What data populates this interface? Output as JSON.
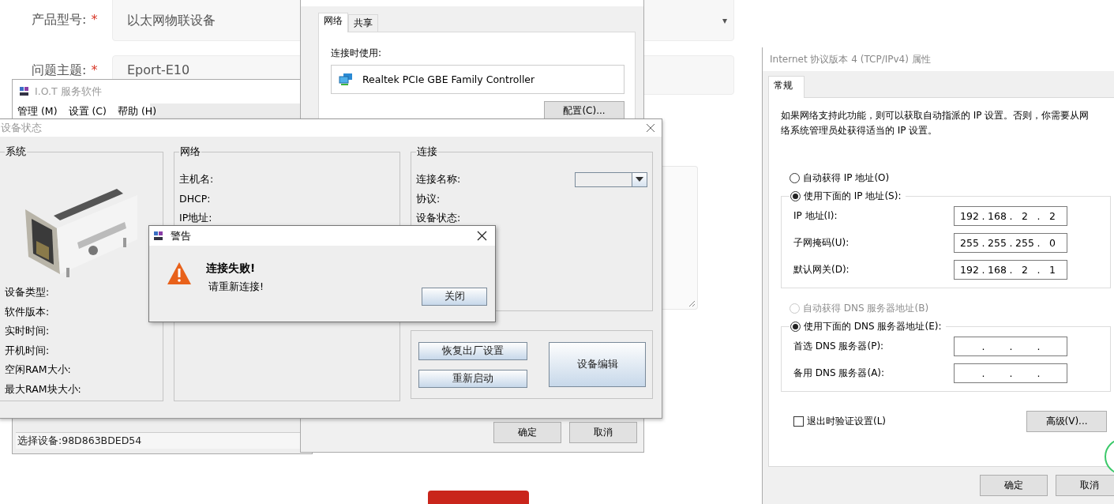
{
  "web_form": {
    "fields": [
      {
        "label": "产品型号:",
        "required_mark": "*",
        "value": "以太网物联设备",
        "caret": "▾"
      },
      {
        "label": "问题主题:",
        "required_mark": "*",
        "value": "Eport-E10"
      }
    ]
  },
  "iot_window": {
    "title": "I.O.T 服务软件",
    "menu": [
      "管理 (M)",
      "设置 (C)",
      "帮助 (H)"
    ],
    "status": "选择设备:98D863BDED54"
  },
  "adapter_window": {
    "tabs": [
      {
        "label": "网络",
        "selected": true
      },
      {
        "label": "共享",
        "selected": false
      }
    ],
    "connect_using": "连接时使用:",
    "adapter": "Realtek PCIe GBE Family Controller",
    "configure_button": "配置(C)...",
    "buttons": [
      "确定",
      "取消"
    ]
  },
  "device_status_window": {
    "title": "设备状态",
    "system_group": {
      "title": "系统",
      "fields": [
        "设备类型:",
        "软件版本:",
        "实时时间:",
        "开机时间:",
        "空闲RAM大小:",
        "最大RAM块大小:"
      ]
    },
    "network_group": {
      "title": "网络",
      "fields": [
        "主机名:",
        "DHCP:",
        "IP地址:"
      ]
    },
    "connection_group": {
      "title": "连接",
      "fields": [
        "连接名称:",
        "协议:",
        "设备状态:"
      ]
    },
    "buttons": [
      "恢复出厂设置",
      "重新启动",
      "设备编辑"
    ]
  },
  "warning_dialog": {
    "title": "警告",
    "heading": "连接失败!",
    "message": "请重新连接!",
    "button": "关闭"
  },
  "ipv4_window": {
    "title": "Internet 协议版本 4 (TCP/IPv4) 属性",
    "tabs": [
      {
        "label": "常规",
        "selected": true
      }
    ],
    "description": "如果网络支持此功能，则可以获取自动指派的 IP 设置。否则，你需要从网络系统管理员处获得适当的 IP 设置。",
    "octet_separator": ".",
    "ip_options": [
      {
        "label": "自动获得 IP 地址(O)",
        "selected": false,
        "disabled": false
      },
      {
        "label": "使用下面的 IP 地址(S):",
        "selected": true,
        "disabled": false
      }
    ],
    "ip_fields": [
      {
        "label": "IP 地址(I):",
        "octets": [
          "192",
          "168",
          "2",
          "2"
        ]
      },
      {
        "label": "子网掩码(U):",
        "octets": [
          "255",
          "255",
          "255",
          "0"
        ]
      },
      {
        "label": "默认网关(D):",
        "octets": [
          "192",
          "168",
          "2",
          "1"
        ]
      }
    ],
    "dns_options": [
      {
        "label": "自动获得 DNS 服务器地址(B)",
        "selected": false,
        "disabled": true
      },
      {
        "label": "使用下面的 DNS 服务器地址(E):",
        "selected": true,
        "disabled": false
      }
    ],
    "dns_fields": [
      {
        "label": "首选 DNS 服务器(P):"
      },
      {
        "label": "备用 DNS 服务器(A):"
      }
    ],
    "validate_checkbox": {
      "label": "退出时验证设置(L)",
      "checked": false
    },
    "advanced_button": "高级(V)...",
    "buttons": [
      "确定",
      "取消"
    ]
  }
}
